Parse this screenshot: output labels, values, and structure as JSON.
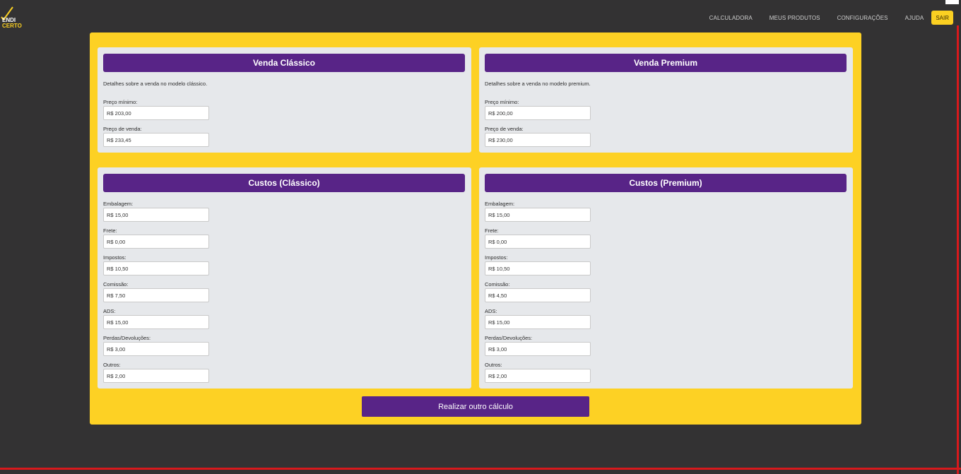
{
  "app": {
    "logo_line1": "ENDI",
    "logo_line2": "CERTO",
    "brand_color": "#fbd022",
    "accent_color": "#582487"
  },
  "nav": {
    "items": [
      "CALCULADORA",
      "MEUS PRODUTOS",
      "CONFIGURAÇÕES",
      "AJUDA"
    ],
    "logout": "SAIR"
  },
  "venda_classico": {
    "title": "Venda Clássico",
    "description": "Detalhes sobre a venda no modelo clássico.",
    "fields": [
      {
        "label": "Preço mínimo:",
        "value": "R$ 203,00"
      },
      {
        "label": "Preço de venda:",
        "value": "R$ 233,45"
      }
    ]
  },
  "venda_premium": {
    "title": "Venda Premium",
    "description": "Detalhes sobre a venda no modelo premium.",
    "fields": [
      {
        "label": "Preço mínimo:",
        "value": "R$ 200,00"
      },
      {
        "label": "Preço de venda:",
        "value": "R$ 230,00"
      }
    ]
  },
  "custos_classico": {
    "title": "Custos (Clássico)",
    "fields": [
      {
        "label": "Embalagem:",
        "value": "R$ 15,00"
      },
      {
        "label": "Frete:",
        "value": "R$ 0,00"
      },
      {
        "label": "Impostos:",
        "value": "R$ 10,50"
      },
      {
        "label": "Comissão:",
        "value": "R$ 7,50"
      },
      {
        "label": "ADS:",
        "value": "R$ 15,00"
      },
      {
        "label": "Perdas/Devoluções:",
        "value": "R$ 3,00"
      },
      {
        "label": "Outros:",
        "value": "R$ 2,00"
      }
    ]
  },
  "custos_premium": {
    "title": "Custos (Premium)",
    "fields": [
      {
        "label": "Embalagem:",
        "value": "R$ 15,00"
      },
      {
        "label": "Frete:",
        "value": "R$ 0,00"
      },
      {
        "label": "Impostos:",
        "value": "R$ 10,50"
      },
      {
        "label": "Comissão:",
        "value": "R$ 4,50"
      },
      {
        "label": "ADS:",
        "value": "R$ 15,00"
      },
      {
        "label": "Perdas/Devoluções:",
        "value": "R$ 3,00"
      },
      {
        "label": "Outros:",
        "value": "R$ 2,00"
      }
    ]
  },
  "actions": {
    "recalculate": "Realizar outro cálculo"
  }
}
